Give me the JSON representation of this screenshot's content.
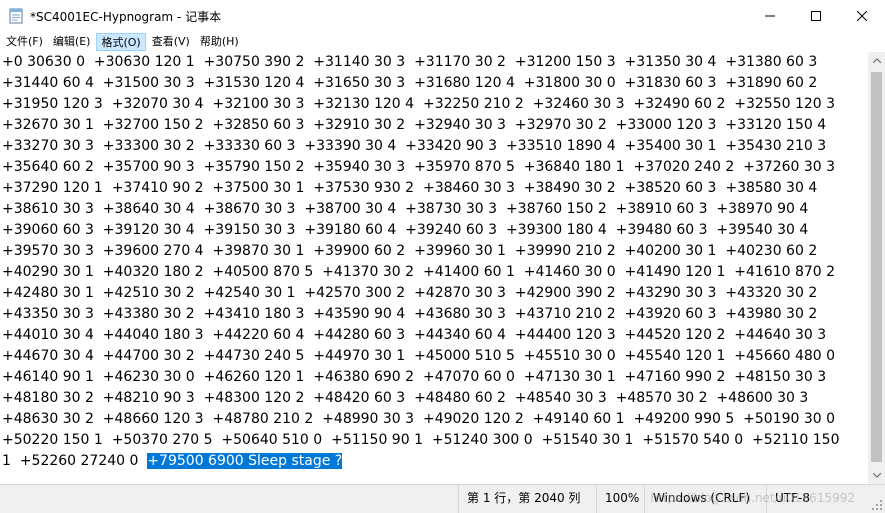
{
  "window": {
    "title": "*SC4001EC-Hypnogram - 记事本",
    "app_icon": "notepad-icon"
  },
  "controls": {
    "minimize_icon": "minimize-icon",
    "maximize_icon": "maximize-icon",
    "close_icon": "close-icon"
  },
  "menu": [
    {
      "label": "文件(F)"
    },
    {
      "label": "编辑(E)"
    },
    {
      "label": "格式(O)"
    },
    {
      "label": "查看(V)"
    },
    {
      "label": "帮助(H)"
    }
  ],
  "editor": {
    "lines": [
      "+0 30630 0  +30630 120 1  +30750 390 2  +31140 30 3  +31170 30 2  +31200 150 3  +31350 30 4  +31380 60 3",
      "+31440 60 4  +31500 30 3  +31530 120 4  +31650 30 3  +31680 120 4  +31800 30 0  +31830 60 3  +31890 60 2",
      "+31950 120 3  +32070 30 4  +32100 30 3  +32130 120 4  +32250 210 2  +32460 30 3  +32490 60 2  +32550 120 3",
      "+32670 30 1  +32700 150 2  +32850 60 3  +32910 30 2  +32940 30 3  +32970 30 2  +33000 120 3  +33120 150 4",
      "+33270 30 3  +33300 30 2  +33330 60 3  +33390 30 4  +33420 90 3  +33510 1890 4  +35400 30 1  +35430 210 3",
      "+35640 60 2  +35700 90 3  +35790 150 2  +35940 30 3  +35970 870 5  +36840 180 1  +37020 240 2  +37260 30 3",
      "+37290 120 1  +37410 90 2  +37500 30 1  +37530 930 2  +38460 30 3  +38490 30 2  +38520 60 3  +38580 30 4",
      "+38610 30 3  +38640 30 4  +38670 30 3  +38700 30 4  +38730 30 3  +38760 150 2  +38910 60 3  +38970 90 4",
      "+39060 60 3  +39120 30 4  +39150 30 3  +39180 60 4  +39240 60 3  +39300 180 4  +39480 60 3  +39540 30 4",
      "+39570 30 3  +39600 270 4  +39870 30 1  +39900 60 2  +39960 30 1  +39990 210 2  +40200 30 1  +40230 60 2",
      "+40290 30 1  +40320 180 2  +40500 870 5  +41370 30 2  +41400 60 1  +41460 30 0  +41490 120 1  +41610 870 2",
      "+42480 30 1  +42510 30 2  +42540 30 1  +42570 300 2  +42870 30 3  +42900 390 2  +43290 30 3  +43320 30 2",
      "+43350 30 3  +43380 30 2  +43410 180 3  +43590 90 4  +43680 30 3  +43710 210 2  +43920 60 3  +43980 30 2",
      "+44010 30 4  +44040 180 3  +44220 60 4  +44280 60 3  +44340 60 4  +44400 120 3  +44520 120 2  +44640 30 3",
      "+44670 30 4  +44700 30 2  +44730 240 5  +44970 30 1  +45000 510 5  +45510 30 0  +45540 120 1  +45660 480 0",
      "+46140 90 1  +46230 30 0  +46260 120 1  +46380 690 2  +47070 60 0  +47130 30 1  +47160 990 2  +48150 30 3",
      "+48180 30 2  +48210 90 3  +48300 120 2  +48420 60 3  +48480 60 2  +48540 30 3  +48570 30 2  +48600 30 3",
      "+48630 30 2  +48660 120 3  +48780 210 2  +48990 30 3  +49020 120 2  +49140 60 1  +49200 990 5  +50190 30 0",
      "+50220 150 1  +50370 270 5  +50640 510 0  +51150 90 1  +51240 300 0  +51540 30 1  +51570 540 0  +52110 150"
    ],
    "last_line_plain": "1  +52260 27240 0  ",
    "last_line_selected": "+79500 6900 Sleep stage ?"
  },
  "status": {
    "position": "第 1 行，第 2040 列",
    "zoom": "100%",
    "line_ending": "Windows (CRLF)",
    "encoding": "UTF-8",
    "watermark": "https://blog.csdn.net/u013615992"
  },
  "colors": {
    "selection": "#0078d7",
    "menu_active": "#cce8ff"
  }
}
